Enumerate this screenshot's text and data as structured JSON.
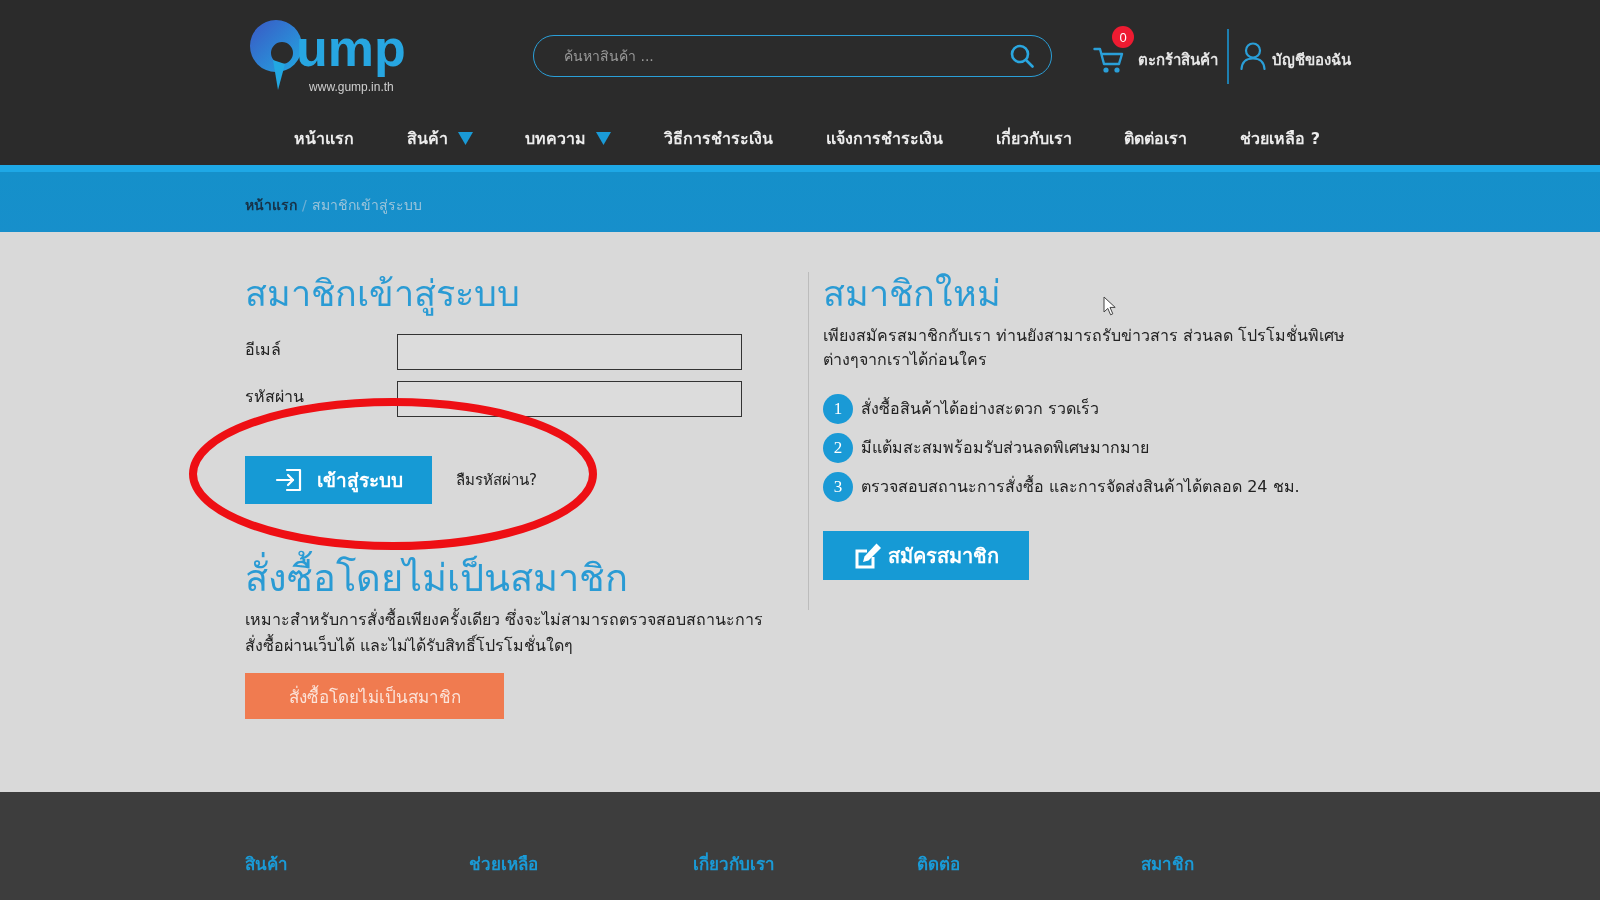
{
  "header": {
    "logo": {
      "wordmark": "ump",
      "url": "www.gump.in.th"
    },
    "search": {
      "placeholder": "ค้นหาสินค้า ..."
    },
    "cart": {
      "label": "ตะกร้าสินค้า",
      "count": "0"
    },
    "account": {
      "label": "บัญชีของฉัน"
    }
  },
  "nav": [
    {
      "label": "หน้าแรก",
      "has_dropdown": false
    },
    {
      "label": "สินค้า",
      "has_dropdown": true
    },
    {
      "label": "บทความ",
      "has_dropdown": true
    },
    {
      "label": "วิธีการชำระเงิน",
      "has_dropdown": false
    },
    {
      "label": "แจ้งการชำระเงิน",
      "has_dropdown": false
    },
    {
      "label": "เกี่ยวกับเรา",
      "has_dropdown": false
    },
    {
      "label": "ติดต่อเรา",
      "has_dropdown": false
    },
    {
      "label": "ช่วยเหลือ ?",
      "has_dropdown": false
    }
  ],
  "breadcrumb": {
    "separator": "/",
    "items": [
      {
        "label": "หน้าแรก",
        "current": false
      },
      {
        "label": "สมาชิกเข้าสู่ระบบ",
        "current": true
      }
    ]
  },
  "login": {
    "title": "สมาชิกเข้าสู่ระบบ",
    "fields": [
      {
        "label": "อีเมล์"
      },
      {
        "label": "รหัสผ่าน"
      }
    ],
    "submit": "เข้าสู่ระบบ",
    "forgot_link": "ลืมรหัสผ่าน?",
    "highlighted": true
  },
  "guest": {
    "title": "สั่งซื้อโดยไม่เป็นสมาชิก",
    "description": "เหมาะสำหรับการสั่งซื้อเพียงครั้งเดียว ซึ่งจะไม่สามารถตรวจสอบสถานะการสั่งซื้อผ่านเว็บได้ และไม่ได้รับสิทธิ์โปรโมชั่นใดๆ",
    "button": "สั่งซื้อโดยไม่เป็นสมาชิก"
  },
  "register": {
    "title": "สมาชิกใหม่",
    "description": "เพียงสมัครสมาชิกกับเรา ท่านยังสามารถรับข่าวสาร ส่วนลด โปรโมชั่นพิเศษต่างๆจากเราได้ก่อนใคร",
    "benefits": [
      {
        "number": "1",
        "text": "สั่งซื้อสินค้าได้อย่างสะดวก รวดเร็ว"
      },
      {
        "number": "2",
        "text": "มีแต้มสะสมพร้อมรับส่วนลดพิเศษมากมาย"
      },
      {
        "number": "3",
        "text": "ตรวจสอบสถานะการสั่งซื้อ และการจัดส่งสินค้าได้ตลอด 24 ชม."
      }
    ],
    "button": "สมัครสมาชิก"
  },
  "footer": {
    "columns": [
      {
        "heading": "สินค้า"
      },
      {
        "heading": "ช่วยเหลือ"
      },
      {
        "heading": "เกี่ยวกับเรา"
      },
      {
        "heading": "ติดต่อ"
      },
      {
        "heading": "สมาชิก"
      }
    ]
  }
}
